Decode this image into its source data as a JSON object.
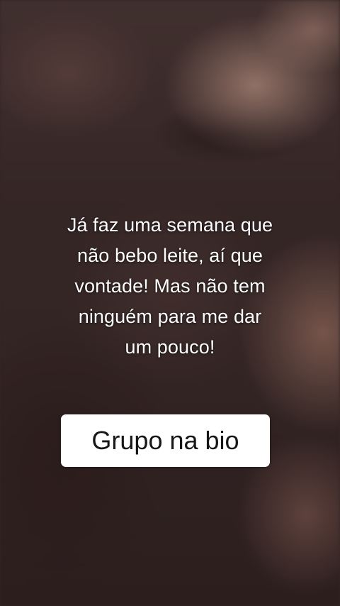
{
  "caption": {
    "lines": [
      "Já faz uma semana que",
      "não bebo leite, aí que",
      "vontade! Mas não tem",
      "ninguém para me dar",
      "um pouco!"
    ]
  },
  "cta": {
    "label": "Grupo na bio"
  },
  "colors": {
    "text": "#ffffff",
    "button_bg": "#ffffff",
    "button_text": "#161616",
    "background_dark": "#3a2b2a",
    "background_light": "#be9687"
  }
}
